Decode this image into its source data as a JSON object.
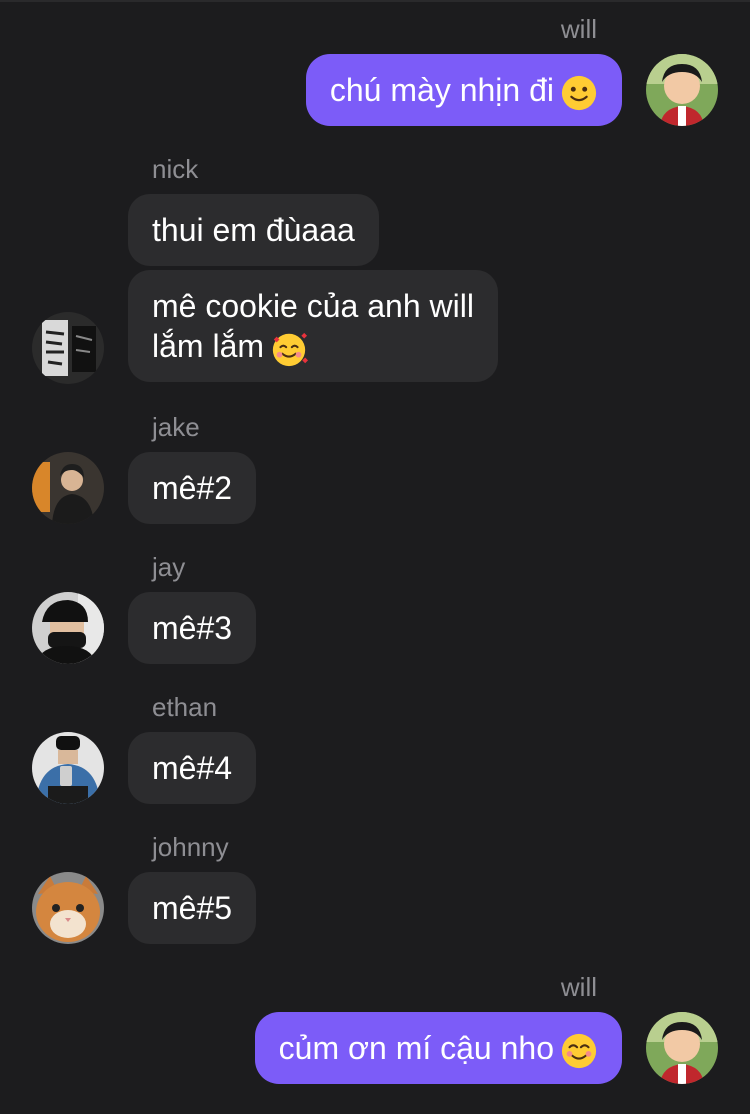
{
  "colors": {
    "background": "#1c1c1e",
    "outgoing_bubble": "#7c5cf8",
    "incoming_bubble": "#2c2c2e",
    "sender_name": "#8e8e93",
    "text": "#ffffff"
  },
  "messages": [
    {
      "sender": "will",
      "text": "chú mày nhịn đi",
      "emoji": "slightly-smiling-face-emoji",
      "direction": "outgoing",
      "avatar": "will-avatar"
    },
    {
      "sender": "nick",
      "text": "thui em đùaaa",
      "direction": "incoming"
    },
    {
      "text_line1": "mê cookie của anh will",
      "text_line2": "lắm lắm",
      "emoji": "smiling-face-with-hearts-emoji",
      "direction": "incoming",
      "avatar": "nick-avatar"
    },
    {
      "sender": "jake",
      "text": "mê#2",
      "direction": "incoming",
      "avatar": "jake-avatar"
    },
    {
      "sender": "jay",
      "text": "mê#3",
      "direction": "incoming",
      "avatar": "jay-avatar"
    },
    {
      "sender": "ethan",
      "text": "mê#4",
      "direction": "incoming",
      "avatar": "ethan-avatar"
    },
    {
      "sender": "johnny",
      "text": "mê#5",
      "direction": "incoming",
      "avatar": "johnny-cat-avatar"
    },
    {
      "sender": "will",
      "text": "củm ơn mí cậu nho",
      "emoji": "smiling-face-emoji",
      "direction": "outgoing",
      "avatar": "will-avatar"
    }
  ]
}
